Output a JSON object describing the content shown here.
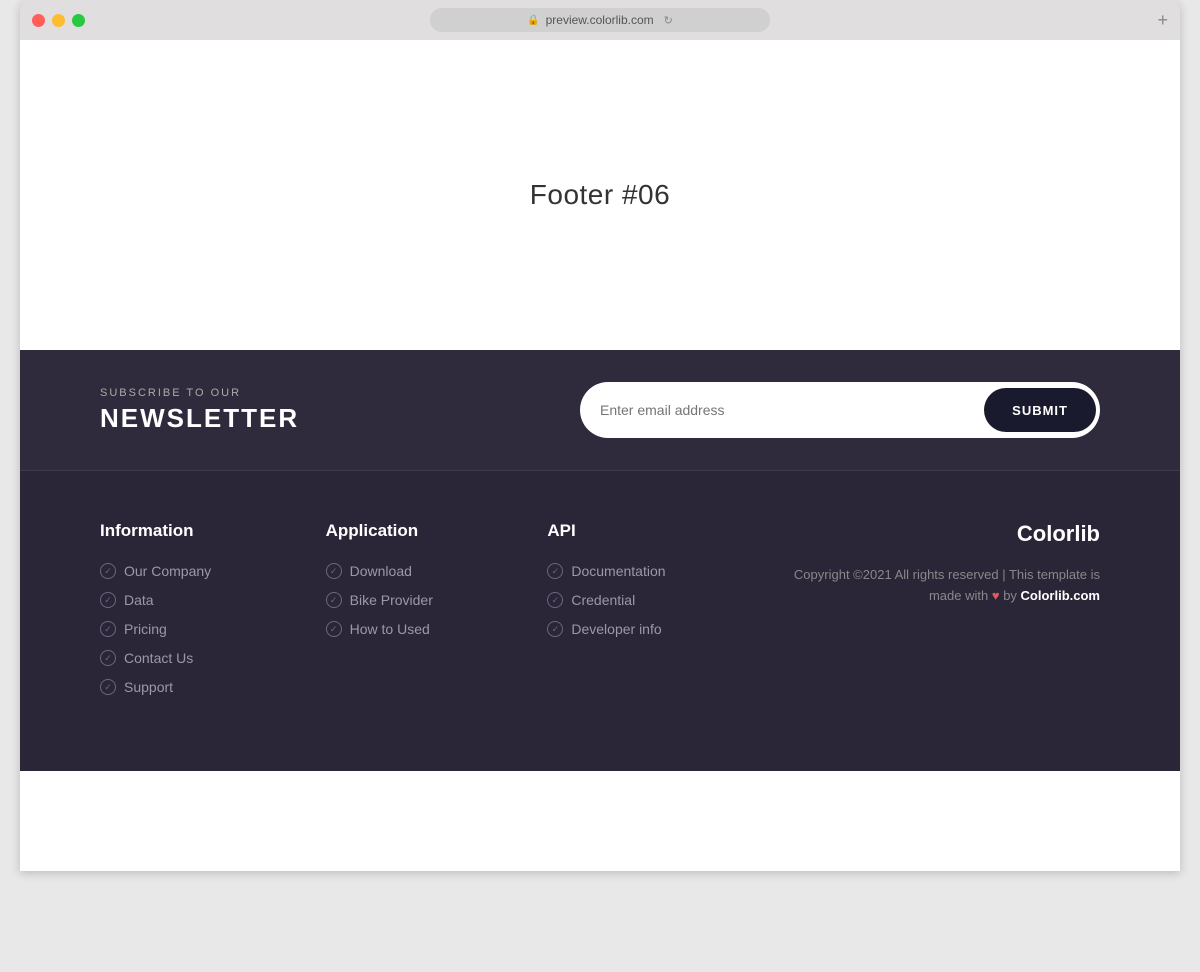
{
  "browser": {
    "url": "preview.colorlib.com",
    "new_tab_icon": "+"
  },
  "main": {
    "title": "Footer #06"
  },
  "newsletter": {
    "subscribe_label": "SUBSCRIBE TO OUR",
    "title": "NEWSLETTER",
    "input_placeholder": "Enter email address",
    "submit_label": "SUBMIT"
  },
  "footer": {
    "columns": [
      {
        "id": "information",
        "title": "Information",
        "links": [
          {
            "label": "Our Company"
          },
          {
            "label": "Data"
          },
          {
            "label": "Pricing"
          },
          {
            "label": "Contact Us"
          },
          {
            "label": "Support"
          }
        ]
      },
      {
        "id": "application",
        "title": "Application",
        "links": [
          {
            "label": "Download"
          },
          {
            "label": "Bike Provider"
          },
          {
            "label": "How to Used"
          }
        ]
      },
      {
        "id": "api",
        "title": "API",
        "links": [
          {
            "label": "Documentation"
          },
          {
            "label": "Credential"
          },
          {
            "label": "Developer info"
          }
        ]
      }
    ],
    "brand": "Colorlib",
    "copyright": "Copyright ©2021 All rights reserved | This template is made with",
    "heart": "♥",
    "by_text": "by",
    "colorlib_link": "Colorlib.com"
  }
}
